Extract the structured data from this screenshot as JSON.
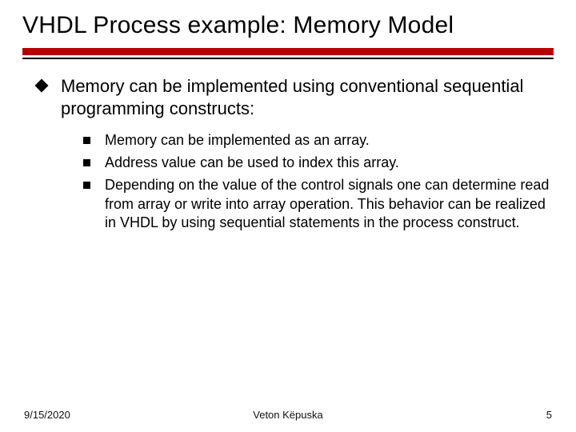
{
  "title": "VHDL Process example: Memory Model",
  "main_point": "Memory can be implemented using conventional sequential programming constructs:",
  "sub_points": [
    "Memory can be implemented as an array.",
    "Address value can be used to index this array.",
    "Depending on the value of the control signals one can determine read from array or write into array operation. This behavior can be realized in VHDL by using sequential statements in the process construct."
  ],
  "footer": {
    "date": "9/15/2020",
    "author": "Veton Këpuska",
    "page": "5"
  }
}
